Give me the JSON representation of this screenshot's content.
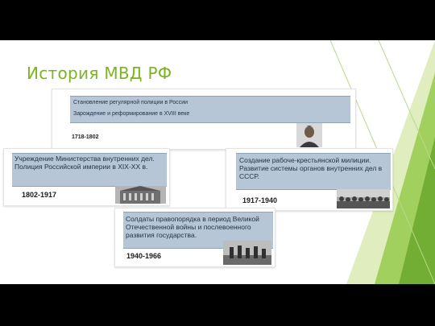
{
  "slide": {
    "title": "История МВД РФ"
  },
  "cards": {
    "top": {
      "line1": "Становление регулярной полиции в России",
      "line2": "Зарождение и реформирование в XVIII веке",
      "years": "1718-1802",
      "image": "portrait-icon"
    },
    "left": {
      "text": "Учреждение Министерства внутренних дел. Полиция Российской империи в XIX-XX в.",
      "years": "1802-1917",
      "image": "building-photo"
    },
    "right": {
      "text": "Создание рабоче-крестьянской милиции. Развитие системы органов внутренних дел в СССР.",
      "years": "1917-1940",
      "image": "crowd-photo"
    },
    "bottom": {
      "text": "Солдаты правопорядка в период Великой Отечественной войны и послевоенного развития государства.",
      "years": "1940-1966",
      "image": "soldiers-photo"
    }
  },
  "colors": {
    "title": "#7ab51d",
    "band": "#b6c6d6",
    "band_text": "#21344a",
    "deco_green": "#8dc63f"
  }
}
